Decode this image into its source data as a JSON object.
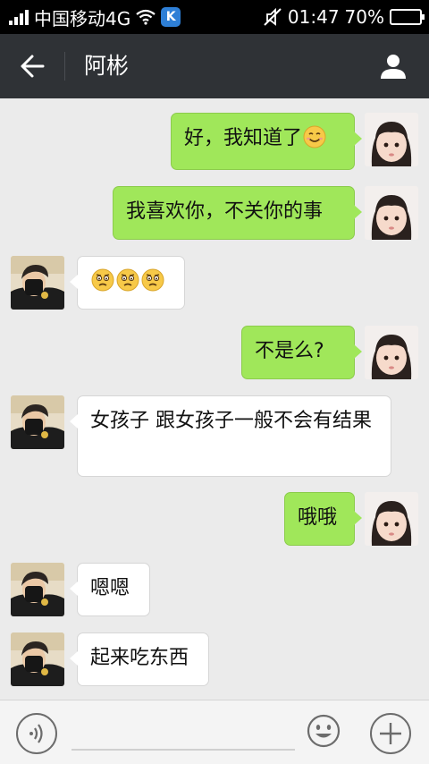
{
  "status_bar": {
    "carrier": "中国移动4G",
    "time": "01:47",
    "battery": "70%",
    "battery_level": 0.7,
    "app_badge": "K"
  },
  "header": {
    "title": "阿彬"
  },
  "messages": [
    {
      "side": "out",
      "text": "好，我知道了",
      "emoji": "smile"
    },
    {
      "side": "out",
      "text": "我喜欢你，不关你的事"
    },
    {
      "side": "in",
      "text": "",
      "emoji": "worried x3"
    },
    {
      "side": "out",
      "text": "不是么?"
    },
    {
      "side": "in",
      "text": "女孩子 跟女孩子一般不会有结果"
    },
    {
      "side": "out",
      "text": "哦哦"
    },
    {
      "side": "in",
      "text": "嗯嗯"
    },
    {
      "side": "in",
      "text": "起来吃东西"
    }
  ],
  "colors": {
    "outgoing_bubble": "#a0e75a",
    "incoming_bubble": "#ffffff",
    "header_bg": "#2f3236",
    "chat_bg": "#ebebeb"
  },
  "input": {
    "value": "",
    "placeholder": ""
  }
}
